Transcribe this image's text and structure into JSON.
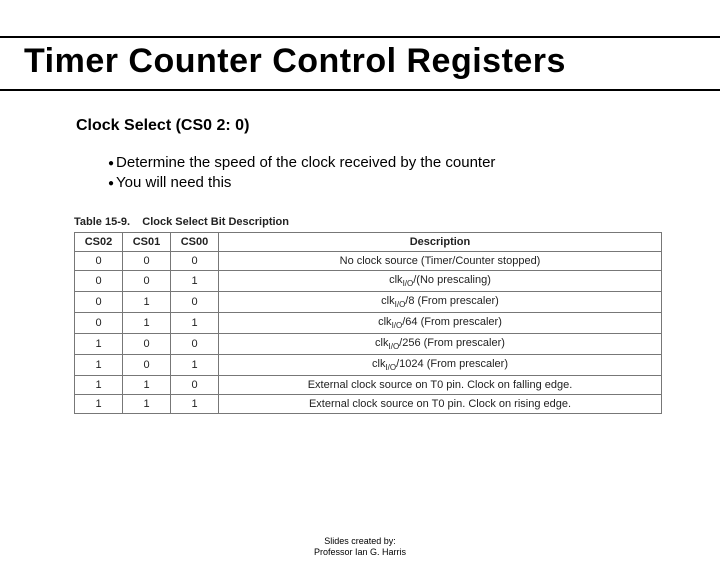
{
  "title": "Timer Counter Control Registers",
  "subtitle": "Clock Select (CS0 2: 0)",
  "bullets": [
    "Determine the speed of the clock received by the counter",
    "You will need this"
  ],
  "table": {
    "caption_label": "Table 15-9.",
    "caption_text": "Clock Select Bit Description",
    "headers": [
      "CS02",
      "CS01",
      "CS00",
      "Description"
    ],
    "rows": [
      {
        "bits": [
          "0",
          "0",
          "0"
        ],
        "desc_plain": "No clock source (Timer/Counter stopped)"
      },
      {
        "bits": [
          "0",
          "0",
          "1"
        ],
        "desc_html": "clk<sub>I/O</sub>/(No prescaling)"
      },
      {
        "bits": [
          "0",
          "1",
          "0"
        ],
        "desc_html": "clk<sub>I/O</sub>/8 (From prescaler)"
      },
      {
        "bits": [
          "0",
          "1",
          "1"
        ],
        "desc_html": "clk<sub>I/O</sub>/64 (From prescaler)"
      },
      {
        "bits": [
          "1",
          "0",
          "0"
        ],
        "desc_html": "clk<sub>I/O</sub>/256 (From prescaler)"
      },
      {
        "bits": [
          "1",
          "0",
          "1"
        ],
        "desc_html": "clk<sub>I/O</sub>/1024 (From prescaler)"
      },
      {
        "bits": [
          "1",
          "1",
          "0"
        ],
        "desc_plain": "External clock source on T0 pin. Clock on falling edge."
      },
      {
        "bits": [
          "1",
          "1",
          "1"
        ],
        "desc_plain": "External clock source on T0 pin. Clock on rising edge."
      }
    ]
  },
  "footer": {
    "line1": "Slides created by:",
    "line2": "Professor Ian G. Harris"
  },
  "chart_data": {
    "type": "table",
    "title": "Clock Select Bit Description",
    "columns": [
      "CS02",
      "CS01",
      "CS00",
      "Description"
    ],
    "rows": [
      [
        "0",
        "0",
        "0",
        "No clock source (Timer/Counter stopped)"
      ],
      [
        "0",
        "0",
        "1",
        "clk_I/O/(No prescaling)"
      ],
      [
        "0",
        "1",
        "0",
        "clk_I/O/8 (From prescaler)"
      ],
      [
        "0",
        "1",
        "1",
        "clk_I/O/64 (From prescaler)"
      ],
      [
        "1",
        "0",
        "0",
        "clk_I/O/256 (From prescaler)"
      ],
      [
        "1",
        "0",
        "1",
        "clk_I/O/1024 (From prescaler)"
      ],
      [
        "1",
        "1",
        "0",
        "External clock source on T0 pin. Clock on falling edge."
      ],
      [
        "1",
        "1",
        "1",
        "External clock source on T0 pin. Clock on rising edge."
      ]
    ]
  }
}
